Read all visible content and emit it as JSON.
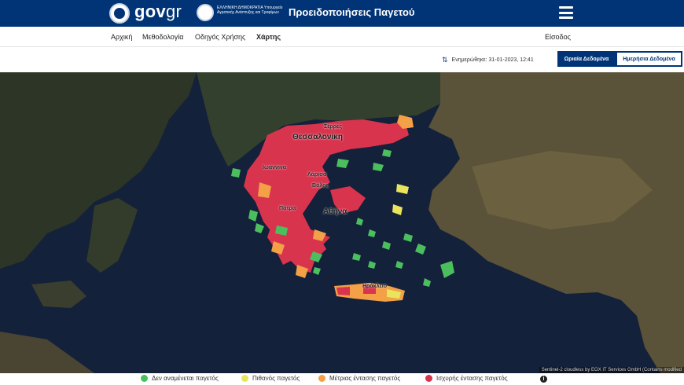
{
  "header": {
    "brand": "gov",
    "brand_suffix": "gr",
    "ministry": "ΕΛΛΗΝΙΚΗ ΔΗΜΟΚΡΑΤΙΑ Υπουργείο Αγροτικής Ανάπτυξης και Τροφίμων",
    "title": "Προειδοποιήσεις Παγετού",
    "menu_icon": "hamburger-icon"
  },
  "nav": {
    "items": [
      "Αρχική",
      "Μεθοδολογία",
      "Οδηγός Χρήσης",
      "Χάρτης"
    ],
    "active": "Χάρτης",
    "login": "Είσοδος"
  },
  "toolbar": {
    "updated": "Ενημερώθηκε: 31-01-2023, 12:41",
    "refresh_icon": "refresh-icon",
    "hourly_button": "Ωριαία Δεδομένα",
    "daily_button": "Ημερήσια Δεδομένα"
  },
  "map": {
    "labels": [
      "Σέρρες",
      "Θεσσαλονίκη",
      "Ιωάννινα",
      "Λάρισα",
      "Βόλος",
      "Πάτρα",
      "Αθήνα",
      "Ηράκλειο"
    ],
    "attribution": "Sentinel-2 cloudless by EOX IT Services GmbH (Contains modified"
  },
  "legend": {
    "items": [
      {
        "label": "Δεν αναμένεται παγετός",
        "color": "#4bbf5e"
      },
      {
        "label": "Πιθανός παγετός",
        "color": "#e9e45c"
      },
      {
        "label": "Μέτριας έντασης παγετός",
        "color": "#f3a047"
      },
      {
        "label": "Ισχυρής έντασης παγετός",
        "color": "#d9344e"
      }
    ],
    "info_icon": "info-icon"
  },
  "colors": {
    "primary": "#003476",
    "sea": "#14213a",
    "strong": "#d9344e",
    "moderate": "#f3a047",
    "possible": "#e9e45c",
    "none": "#4bbf5e"
  }
}
